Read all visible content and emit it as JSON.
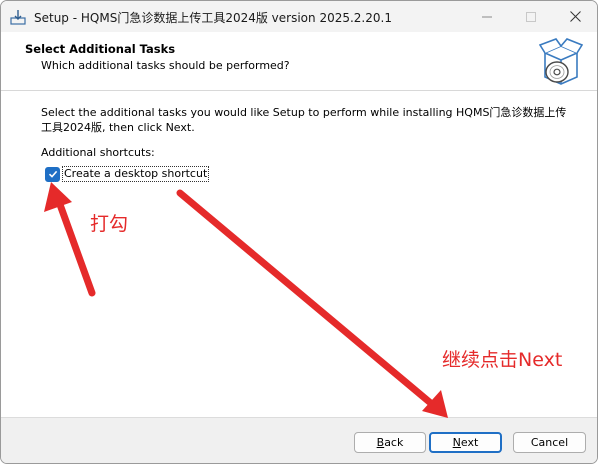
{
  "window": {
    "title": "Setup - HQMS门急诊数据上传工具2024版 version 2025.2.20.1",
    "minimize_icon": "minimize-icon",
    "maximize_icon": "maximize-icon",
    "close_icon": "close-icon"
  },
  "header": {
    "title": "Select Additional Tasks",
    "subtitle": "Which additional tasks should be performed?",
    "image_icon": "installer-box-disc-icon"
  },
  "body": {
    "description": "Select the additional tasks you would like Setup to perform while installing HQMS门急诊数据上传工具2024版, then click Next.",
    "group_label": "Additional shortcuts:",
    "tasks": [
      {
        "label": "Create a desktop shortcut",
        "checked": true
      }
    ]
  },
  "footer": {
    "back": {
      "mnemonic": "B",
      "rest": "ack"
    },
    "next": {
      "mnemonic": "N",
      "rest": "ext"
    },
    "cancel": "Cancel"
  },
  "annotations": {
    "check_note": "打勾",
    "next_note": "继续点击Next",
    "color": "#e52a2a"
  },
  "colors": {
    "accent": "#1f6fc5",
    "titlebar_bg": "#f3f3f3",
    "footer_bg": "#f0f0f0"
  }
}
